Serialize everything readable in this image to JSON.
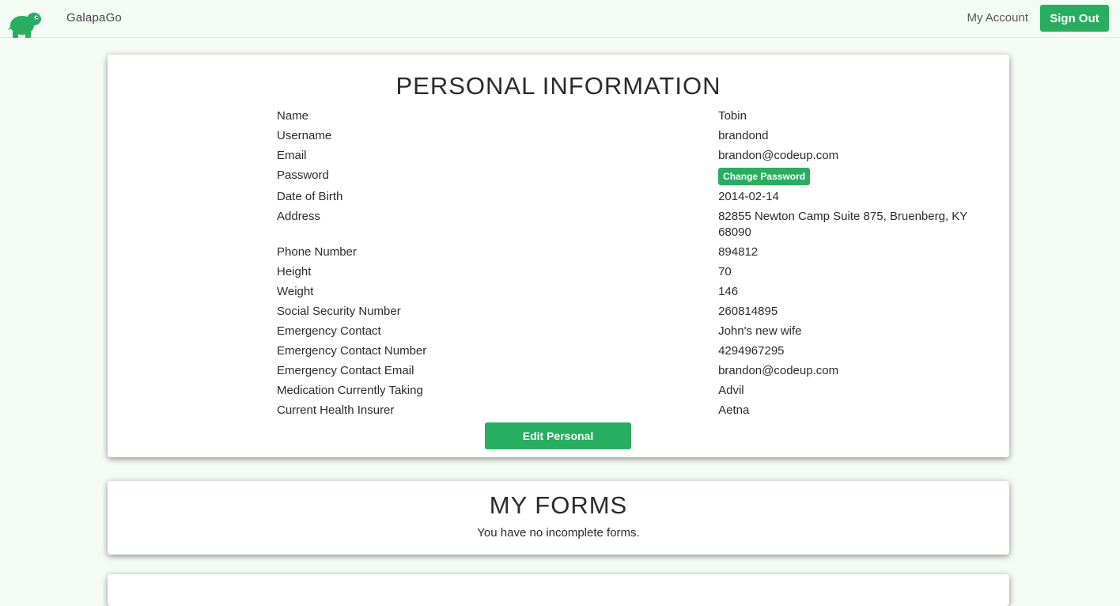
{
  "nav": {
    "brand": "GalapaGo",
    "my_account": "My Account",
    "sign_out": "Sign Out",
    "logo_icon": "turtle-icon",
    "accent": "#27ae60"
  },
  "personal": {
    "title": "PERSONAL INFORMATION",
    "labels": {
      "name": "Name",
      "username": "Username",
      "email": "Email",
      "password": "Password",
      "dob": "Date of Birth",
      "address": "Address",
      "phone": "Phone Number",
      "height": "Height",
      "weight": "Weight",
      "ssn": "Social Security Number",
      "emergency_contact": "Emergency Contact",
      "emergency_number": "Emergency Contact Number",
      "emergency_email": "Emergency Contact Email",
      "medication": "Medication Currently Taking",
      "insurer": "Current Health Insurer"
    },
    "values": {
      "name": "Tobin",
      "username": "brandond",
      "email": "brandon@codeup.com",
      "dob": "2014-02-14",
      "address": "82855 Newton Camp Suite 875, Bruenberg, KY 68090",
      "phone": "894812",
      "height": "70",
      "weight": "146",
      "ssn": "260814895",
      "emergency_contact": "John's new wife",
      "emergency_number": "4294967295",
      "emergency_email": "brandon@codeup.com",
      "medication": "Advil",
      "insurer": "Aetna"
    },
    "change_password_label": "Change Password",
    "edit_label": "Edit Personal"
  },
  "forms": {
    "title": "MY FORMS",
    "empty_message": "You have no incomplete forms."
  }
}
